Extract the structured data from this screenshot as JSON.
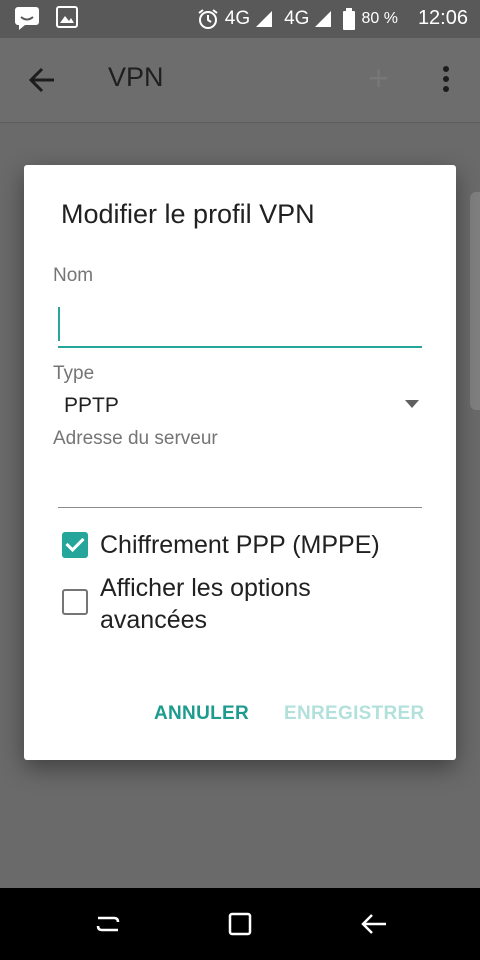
{
  "status": {
    "left_icons": [
      "chat-icon",
      "image-icon"
    ],
    "alarm_icon": "alarm-icon",
    "network1": "4G",
    "network2": "4G",
    "battery_icon": "battery-icon",
    "battery": "80 %",
    "time": "12:06"
  },
  "appbar": {
    "back_icon": "arrow-back-icon",
    "title": "VPN",
    "add_icon": "plus-icon",
    "more_icon": "more-vert-icon"
  },
  "dialog": {
    "title": "Modifier le profil VPN",
    "name_label": "Nom",
    "name_value": "",
    "type_label": "Type",
    "type_value": "PPTP",
    "server_label": "Adresse du serveur",
    "server_value": "",
    "mppe_label": "Chiffrement PPP (MPPE)",
    "mppe_checked": true,
    "advanced_label_line1": "Afficher les options",
    "advanced_label_line2": "avancées",
    "advanced_checked": false,
    "cancel_label": "ANNULER",
    "save_label": "ENREGISTRER"
  },
  "colors": {
    "accent": "#26a69a",
    "save_disabled": "#b2e1dc",
    "scrim": "#6a6a6a"
  },
  "navbar": {
    "icons": [
      "recents-icon",
      "home-icon",
      "back-icon"
    ]
  }
}
